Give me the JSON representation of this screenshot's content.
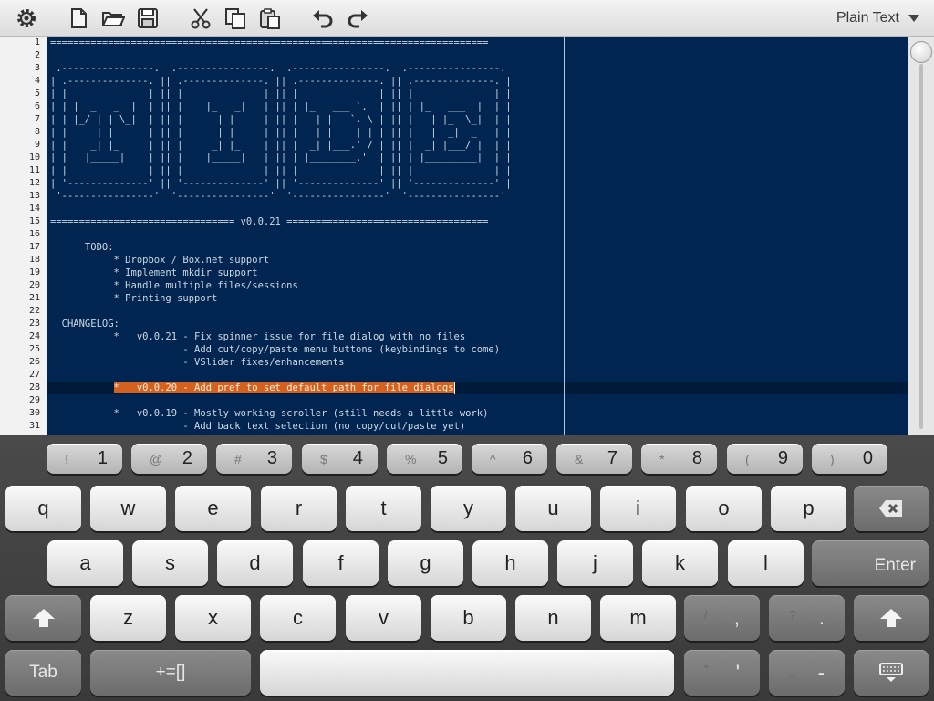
{
  "toolbar": {
    "syntax_mode": "Plain Text"
  },
  "editor": {
    "line_numbers": [
      "1",
      "2",
      "3",
      "4",
      "5",
      "6",
      "7",
      "8",
      "9",
      "10",
      "11",
      "12",
      "13",
      "14",
      "15",
      "16",
      "17",
      "18",
      "19",
      "20",
      "21",
      "22",
      "23",
      "24",
      "25",
      "26",
      "27",
      "28",
      "29",
      "30",
      "31"
    ],
    "lines": [
      "============================================================================",
      "",
      " .----------------.  .----------------.  .----------------.  .----------------.",
      "| .--------------. || .--------------. || .--------------. || .--------------. |",
      "| |  _________   | || |     _____    | || |  ________    | || |  _________   | |",
      "| | |  _   _  |  | || |    |_   _|   | || | |_   ___ `.  | || | |_   ___  |  | |",
      "| | |_/ | | \\_|  | || |      | |     | || |   | |   `. \\ | || |   | |_  \\_|  | |",
      "| |     | |      | || |      | |     | || |   | |    | | | || |   |  _|  _   | |",
      "| |    _| |_     | || |     _| |_    | || |  _| |___.' / | || |  _| |___/ |  | |",
      "| |   |_____|    | || |    |_____|   | || | |________.'  | || | |_________|  | |",
      "| |              | || |              | || |              | || |              | |",
      "| '--------------' || '--------------' || '--------------' || '--------------' |",
      " '----------------'  '----------------'  '----------------'  '----------------'",
      "",
      "================================ v0.0.21 ===================================",
      "",
      "      TODO:",
      "           * Dropbox / Box.net support",
      "           * Implement mkdir support",
      "           * Handle multiple files/sessions",
      "           * Printing support",
      "",
      "  CHANGELOG:",
      "           *   v0.0.21 - Fix spinner issue for file dialog with no files",
      "                       - Add cut/copy/paste menu buttons (keybindings to come)",
      "                       - VSlider fixes/enhancements",
      "",
      "           *   v0.0.20 - Add pref to set default path for file dialogs",
      "",
      "           *   v0.0.19 - Mostly working scroller (still needs a little work)",
      "                       - Add back text selection (no copy/cut/paste yet)"
    ]
  },
  "keyboard": {
    "number_row": [
      {
        "sym": "!",
        "num": "1"
      },
      {
        "sym": "@",
        "num": "2"
      },
      {
        "sym": "#",
        "num": "3"
      },
      {
        "sym": "$",
        "num": "4"
      },
      {
        "sym": "%",
        "num": "5"
      },
      {
        "sym": "^",
        "num": "6"
      },
      {
        "sym": "&",
        "num": "7"
      },
      {
        "sym": "*",
        "num": "8"
      },
      {
        "sym": "(",
        "num": "9"
      },
      {
        "sym": ")",
        "num": "0"
      }
    ],
    "row1": [
      "q",
      "w",
      "e",
      "r",
      "t",
      "y",
      "u",
      "i",
      "o",
      "p"
    ],
    "row2": [
      "a",
      "s",
      "d",
      "f",
      "g",
      "h",
      "j",
      "k",
      "l"
    ],
    "row3": [
      "z",
      "x",
      "c",
      "v",
      "b",
      "n",
      "m"
    ],
    "enter_label": "Enter",
    "tab_label": "Tab",
    "symbols_label": "+=[]",
    "comma_key": {
      "sub": "/",
      "main": ","
    },
    "period_key": {
      "sub": "?",
      "main": "."
    },
    "quote_key": {
      "sub": "\"",
      "main": "'"
    },
    "dash_key": {
      "sub": "_",
      "main": "-"
    }
  }
}
